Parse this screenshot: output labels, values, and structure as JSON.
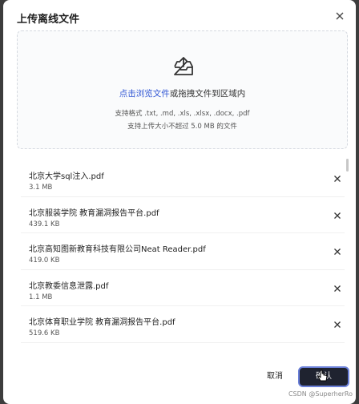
{
  "dialog": {
    "title": "上传离线文件",
    "close_icon": "close-icon"
  },
  "dropzone": {
    "icon": "upload-tray-icon",
    "link_text": "点击浏览文件",
    "rest_text": "或拖拽文件到区域内",
    "formats_hint": "支持格式 .txt, .md, .xls, .xlsx, .docx, .pdf",
    "size_hint": "支持上传大小不超过 5.0 MB 的文件"
  },
  "files": [
    {
      "name": "北京大学sql注入.pdf",
      "size": "3.1 MB"
    },
    {
      "name": "北京服装学院 教育漏洞报告平台.pdf",
      "size": "439.1 KB"
    },
    {
      "name": "北京高知图新教育科技有限公司Neat Reader.pdf",
      "size": "419.0 KB"
    },
    {
      "name": "北京教委信息泄露.pdf",
      "size": "1.1 MB"
    },
    {
      "name": "北京体育职业学院 教育漏洞报告平台.pdf",
      "size": "519.6 KB"
    }
  ],
  "footer": {
    "cancel_label": "取消",
    "confirm_label": "确认"
  },
  "watermark": "CSDN @SuperherRo",
  "colors": {
    "link": "#2f55d4",
    "confirm_bg": "#1f2330",
    "backdrop": "#3d3d3d"
  }
}
